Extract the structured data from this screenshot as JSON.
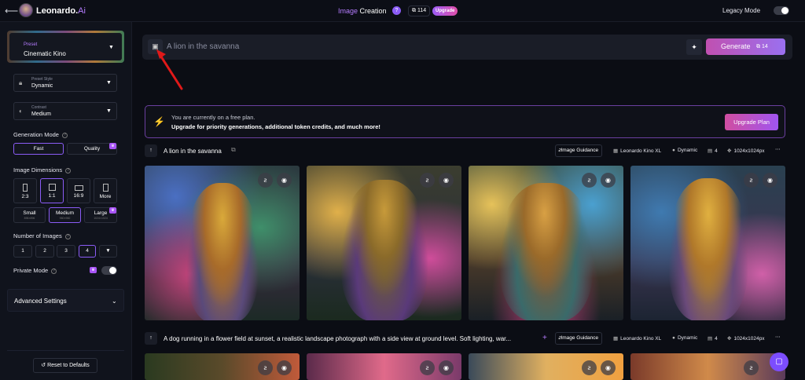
{
  "topbar": {
    "back_icon": "back-arrow-icon",
    "brand_name": "Leonardo.",
    "brand_suffix": "Ai",
    "mode_a": "Image",
    "mode_b": "Creation",
    "tokens": "114",
    "upgrade_label": "Upgrade",
    "legacy_label": "Legacy Mode"
  },
  "sidebar": {
    "preset_label": "Preset",
    "preset_value": "Cinematic Kino",
    "preset_style_label": "Preset Style",
    "preset_style_value": "Dynamic",
    "contrast_label": "Contrast",
    "contrast_value": "Medium",
    "generation_mode_title": "Generation Mode",
    "mode_fast": "Fast",
    "mode_quality": "Quality",
    "image_dimensions_title": "Image Dimensions",
    "ratios": [
      "2:3",
      "1:1",
      "16:9",
      "More"
    ],
    "sizes": [
      {
        "label": "Small",
        "sub": "896×896"
      },
      {
        "label": "Medium",
        "sub": "960×960"
      },
      {
        "label": "Large",
        "sub": "1024×1024"
      }
    ],
    "number_of_images_title": "Number of Images",
    "counts": [
      "1",
      "2",
      "3",
      "4"
    ],
    "private_mode_title": "Private Mode",
    "advanced_settings": "Advanced Settings",
    "reset_label": "Reset to Defaults"
  },
  "prompt": {
    "text": "A lion in the savanna",
    "generate_label": "Generate",
    "generate_cost": "14"
  },
  "banner": {
    "line1": "You are currently on a free plan.",
    "line2": "Upgrade for priority generations, additional token credits, and much more!",
    "button": "Upgrade Plan"
  },
  "generations": [
    {
      "title": "A lion in the savanna",
      "guidance": "Image Guidance",
      "model": "Leonardo Kino XL",
      "style": "Dynamic",
      "count": "4",
      "size": "1024x1024px"
    },
    {
      "title": "A dog running in a flower field at sunset, a realistic landscape photograph with a side view at ground level. Soft lighting, war...",
      "guidance": "Image Guidance",
      "model": "Leonardo Kino XL",
      "style": "Dynamic",
      "count": "4",
      "size": "1024x1024px"
    }
  ]
}
